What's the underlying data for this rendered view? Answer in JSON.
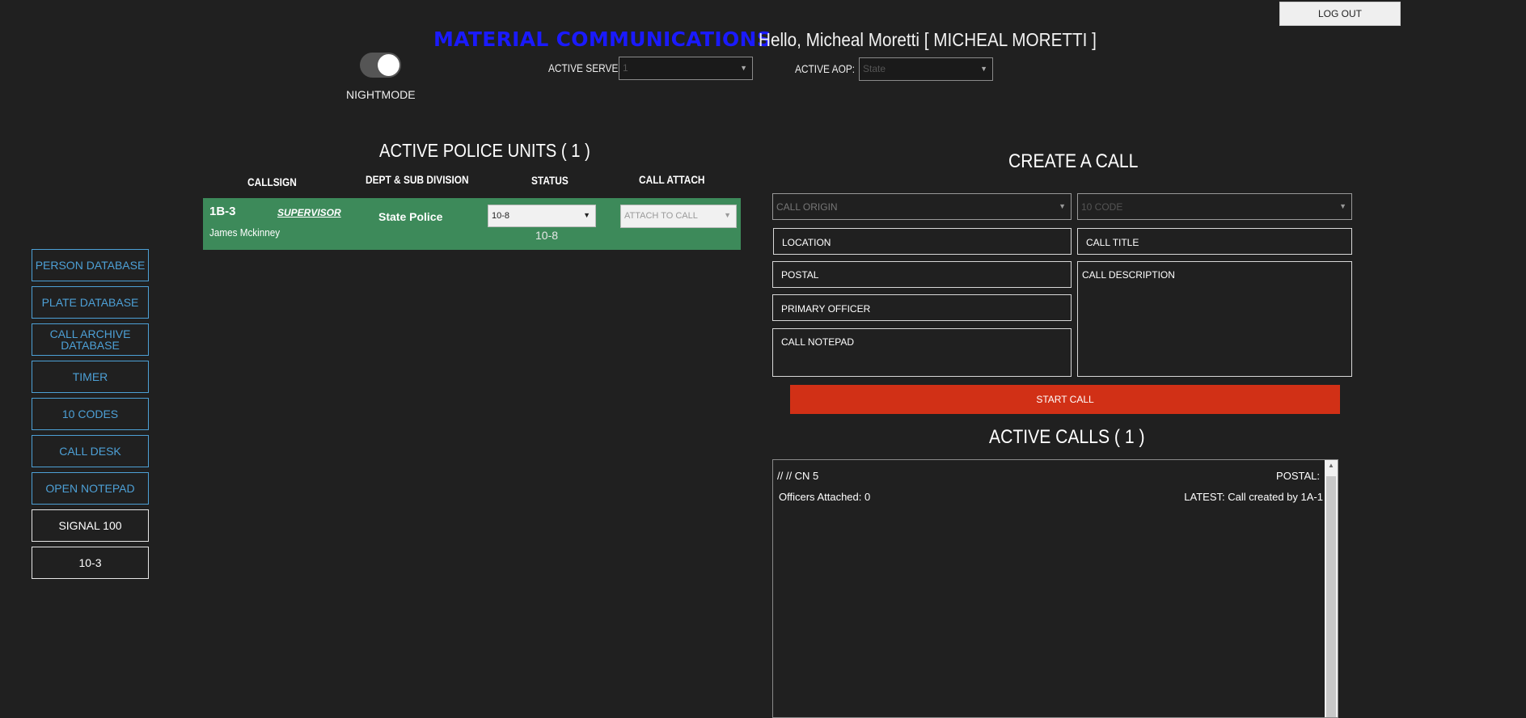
{
  "header": {
    "logout_label": "LOG OUT",
    "brand": "MATERIAL COMMUNICATIONS",
    "greeting": "Hello, Micheal Moretti [ MICHEAL MORETTI ]",
    "nightmode_label": "NIGHTMODE",
    "nightmode_on": true,
    "active_server_label": "ACTIVE SERVER:",
    "active_server_value": "1",
    "active_aop_label": "ACTIVE AOP:",
    "active_aop_value": "State"
  },
  "sidebar": {
    "items": [
      {
        "label": "PERSON DATABASE"
      },
      {
        "label": "PLATE DATABASE"
      },
      {
        "label": "CALL ARCHIVE DATABASE"
      },
      {
        "label": "TIMER"
      },
      {
        "label": "10 CODES"
      },
      {
        "label": "CALL DESK"
      },
      {
        "label": "OPEN NOTEPAD"
      },
      {
        "label": "SIGNAL 100"
      },
      {
        "label": "10-3"
      }
    ]
  },
  "units": {
    "title": "ACTIVE POLICE UNITS ( 1 )",
    "columns": {
      "callsign": "CALLSIGN",
      "dept": "DEPT & SUB DIVISION",
      "status": "STATUS",
      "attach": "CALL ATTACH"
    },
    "rows": [
      {
        "callsign": "1B-3",
        "role": "SUPERVISOR",
        "name": "James Mckinney",
        "dept": "State Police",
        "status_select": "10-8",
        "status_text": "10-8",
        "attach_placeholder": "ATTACH TO CALL",
        "row_color": "#3d8a5a"
      }
    ]
  },
  "create_call": {
    "title": "CREATE A CALL",
    "call_origin_placeholder": "CALL ORIGIN",
    "ten_code_placeholder": "10 CODE",
    "location": "LOCATION",
    "call_title": "CALL TITLE",
    "postal": "POSTAL",
    "call_description": "CALL DESCRIPTION",
    "primary_officer": "PRIMARY OFFICER",
    "call_notepad": "CALL NOTEPAD",
    "start_call": "START CALL",
    "start_color": "#d13016"
  },
  "active_calls": {
    "title": "ACTIVE CALLS ( 1 )",
    "calls": [
      {
        "header_left": "//  // CN 5",
        "header_right": "POSTAL:",
        "officers": "Officers Attached: 0",
        "latest": "LATEST: Call created by 1A-1"
      }
    ]
  },
  "colors": {
    "background": "#202020",
    "brand": "#1a1aff",
    "sidebar_accent": "#4da0d6"
  }
}
